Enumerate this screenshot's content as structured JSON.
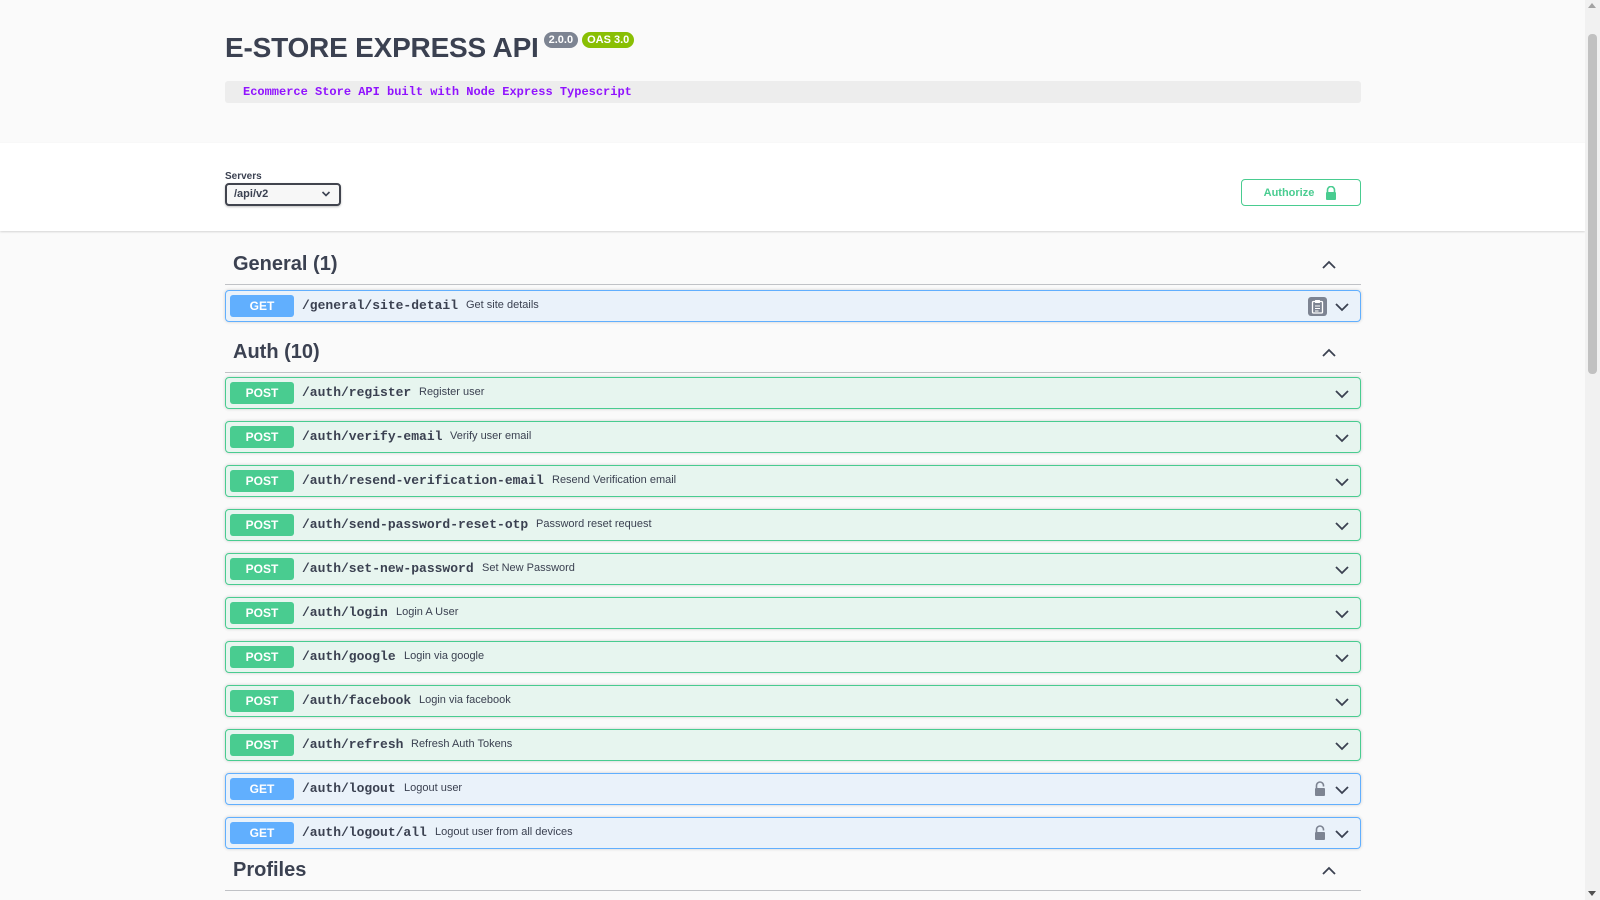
{
  "info": {
    "title": "E-STORE EXPRESS API",
    "version": "2.0.0",
    "oas": "OAS 3.0",
    "description": "Ecommerce Store API built with Node Express Typescript"
  },
  "servers": {
    "label": "Servers",
    "selected": "/api/v2"
  },
  "authorize": {
    "label": "Authorize",
    "icon": "lock-open-icon"
  },
  "colors": {
    "get": "#61affe",
    "post": "#49cc90",
    "description_text": "#9012fe"
  },
  "sections": [
    {
      "name": "General (1)",
      "operations": [
        {
          "method": "GET",
          "path": "/general/site-detail",
          "summary": "Get site details",
          "copy": true,
          "locked": false
        }
      ]
    },
    {
      "name": "Auth (10)",
      "operations": [
        {
          "method": "POST",
          "path": "/auth/register",
          "summary": "Register user",
          "locked": false
        },
        {
          "method": "POST",
          "path": "/auth/verify-email",
          "summary": "Verify user email",
          "locked": false
        },
        {
          "method": "POST",
          "path": "/auth/resend-verification-email",
          "summary": "Resend Verification email",
          "locked": false
        },
        {
          "method": "POST",
          "path": "/auth/send-password-reset-otp",
          "summary": "Password reset request",
          "locked": false
        },
        {
          "method": "POST",
          "path": "/auth/set-new-password",
          "summary": "Set New Password",
          "locked": false
        },
        {
          "method": "POST",
          "path": "/auth/login",
          "summary": "Login A User",
          "locked": false
        },
        {
          "method": "POST",
          "path": "/auth/google",
          "summary": "Login via google",
          "locked": false
        },
        {
          "method": "POST",
          "path": "/auth/facebook",
          "summary": "Login via facebook",
          "locked": false
        },
        {
          "method": "POST",
          "path": "/auth/refresh",
          "summary": "Refresh Auth Tokens",
          "locked": false
        },
        {
          "method": "GET",
          "path": "/auth/logout",
          "summary": "Logout user",
          "locked": true
        },
        {
          "method": "GET",
          "path": "/auth/logout/all",
          "summary": "Logout user from all devices",
          "locked": true
        }
      ]
    },
    {
      "name": "Profiles",
      "operations": []
    }
  ]
}
